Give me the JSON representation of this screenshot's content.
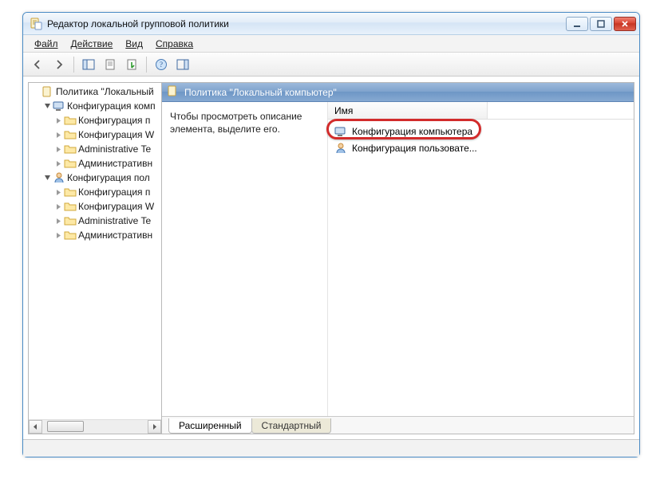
{
  "window": {
    "title": "Редактор локальной групповой политики"
  },
  "menu": {
    "file": "Файл",
    "action": "Действие",
    "view": "Вид",
    "help": "Справка"
  },
  "tree": {
    "root": "Политика \"Локальный",
    "comp": "Конфигурация комп",
    "c1": "Конфигурация п",
    "c2": "Конфигурация W",
    "c3": "Administrative Te",
    "c4": "Административн",
    "user": "Конфигурация пол",
    "u1": "Конфигурация п",
    "u2": "Конфигурация W",
    "u3": "Administrative Te",
    "u4": "Административн"
  },
  "right": {
    "header": "Политика \"Локальный компьютер\"",
    "desc": "Чтобы просмотреть описание элемента, выделите его.",
    "col_name": "Имя",
    "item1": "Конфигурация компьютера",
    "item2": "Конфигурация пользовате..."
  },
  "tabs": {
    "extended": "Расширенный",
    "standard": "Стандартный"
  }
}
